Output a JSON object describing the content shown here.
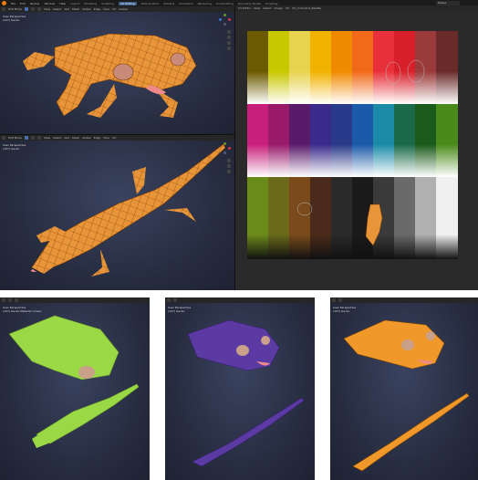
{
  "topbar": {
    "menu": [
      "File",
      "Edit",
      "Render",
      "Window",
      "Help"
    ],
    "workspaces": [
      "Layout",
      "Modeling",
      "Sculpting",
      "UV Editing",
      "Texture Paint",
      "Shading",
      "Animation",
      "Rendering",
      "Compositing",
      "Geometry Nodes",
      "Scripting"
    ],
    "active_workspace": "UV Editing",
    "scene": "Scene"
  },
  "viewport_top": {
    "header": {
      "mode": "Edit Mode",
      "menus": [
        "View",
        "Select",
        "Add",
        "Mesh",
        "Vertex",
        "Edge",
        "Face",
        "UV"
      ],
      "transform": "Global"
    },
    "info_line1": "User Perspective",
    "info_line2": "(107) Gecko"
  },
  "viewport_mid": {
    "header": {
      "mode": "Edit Mode",
      "menus": [
        "View",
        "Select",
        "Add",
        "Mesh",
        "Vertex",
        "Edge",
        "Face",
        "UV"
      ]
    },
    "info_line1": "User Perspective",
    "info_line2": "(107) Gecko"
  },
  "uv_editor": {
    "header": {
      "mode": "UV Editor",
      "menus": [
        "View",
        "Select",
        "Image",
        "UV"
      ],
      "image": "UV_ColorGrid_Palette"
    }
  },
  "bottom_views": [
    {
      "info_line1": "User Perspective",
      "info_line2": "(107) Gecko Material: Green",
      "color": "#8fcf3a"
    },
    {
      "info_line1": "User Perspective",
      "info_line2": "(107) Gecko",
      "color": "#5b3aa3"
    },
    {
      "info_line1": "User Perspective",
      "info_line2": "(107) Gecko",
      "color": "#f0992a"
    }
  ],
  "palette_colors": {
    "row1": [
      "#6b5a00",
      "#c8c800",
      "#e8d34f",
      "#f2b200",
      "#f08a00",
      "#f06a1a",
      "#e8303a",
      "#d8202a",
      "#9a3a3a",
      "#6a2a2a"
    ],
    "row2": [
      "#c8207a",
      "#9a1a6a",
      "#5a1a6a",
      "#3a2a8a",
      "#2a3a8a",
      "#1a5aa8",
      "#1a8aa8",
      "#1a6a4a",
      "#1a5a1a",
      "#4a8a1a"
    ],
    "row3": [
      "#6a8a1a",
      "#6a6a1a",
      "#7a4a1a",
      "#4a2a1a",
      "#2a2a2a",
      "#1a1a1a",
      "#3a3a3a",
      "#6a6a6a",
      "#b0b0b0",
      "#f0f0f0"
    ]
  }
}
